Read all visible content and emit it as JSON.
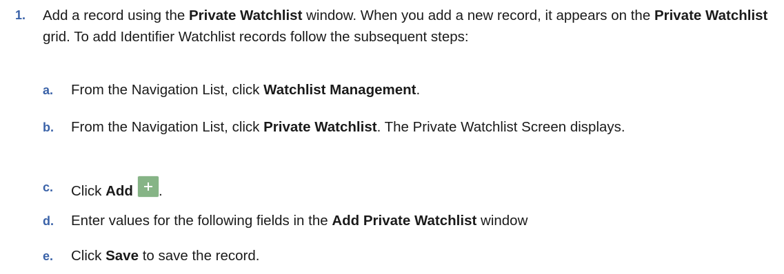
{
  "step1": {
    "number": "1.",
    "text_1": "Add a record using the ",
    "bold_1": "Private Watchlist",
    "text_2": " window. When you add a new record, it appears on the ",
    "bold_2": "Private Watchlist",
    "text_3": " grid. To add Identifier Watchlist records follow the subsequent steps:"
  },
  "substeps": {
    "a": {
      "number": "a.",
      "text_1": "From the Navigation List, click ",
      "bold_1": "Watchlist Management",
      "text_2": "."
    },
    "b": {
      "number": "b.",
      "text_1": "From the Navigation List, click ",
      "bold_1": "Private Watchlist",
      "text_2": ". The Private Watchlist Screen displays."
    },
    "c": {
      "number": "c.",
      "text_1": "Click ",
      "bold_1": "Add",
      "icon": "plus-icon",
      "text_2": "."
    },
    "d": {
      "number": "d.",
      "text_1": "Enter values for the following fields in the ",
      "bold_1": "Add Private Watchlist",
      "text_2": " window"
    },
    "e": {
      "number": "e.",
      "text_1": "Click ",
      "bold_1": "Save",
      "text_2": " to save the record."
    }
  },
  "colors": {
    "step_number": "#3a62a8",
    "add_icon_bg": "#86b486",
    "text": "#1a1a1a"
  }
}
